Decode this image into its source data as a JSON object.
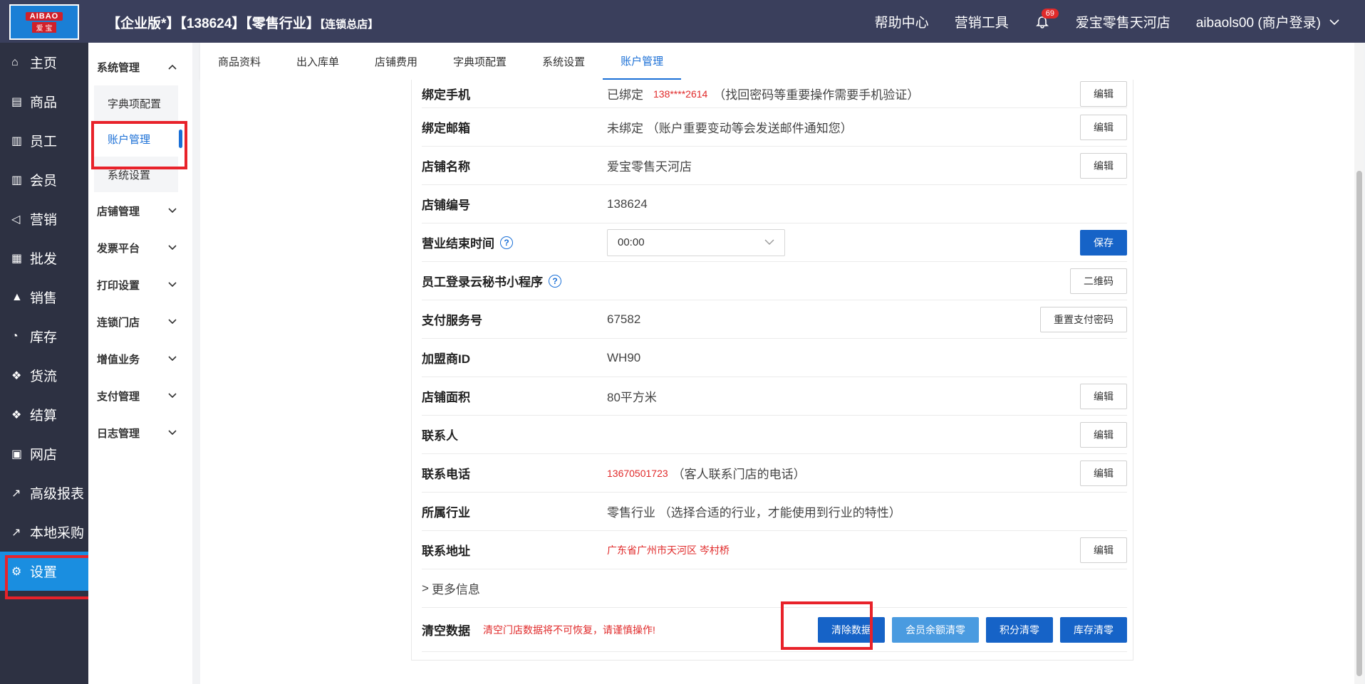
{
  "topbar": {
    "logo_top": "AIBAO",
    "logo_bottom": "爱 宝",
    "version": "【企业版*】【138624】【零售行业】",
    "store_tag": "【连锁总店】",
    "help": "帮助中心",
    "marketing": "营销工具",
    "badge": "69",
    "store": "爱宝零售天河店",
    "user": "aibaols00 (商户登录)"
  },
  "leftnav": [
    {
      "label": "主页",
      "icon": "home-icon"
    },
    {
      "label": "商品",
      "icon": "goods-icon"
    },
    {
      "label": "员工",
      "icon": "staff-icon"
    },
    {
      "label": "会员",
      "icon": "member-icon"
    },
    {
      "label": "营销",
      "icon": "megaphone-icon"
    },
    {
      "label": "批发",
      "icon": "wholesale-icon"
    },
    {
      "label": "销售",
      "icon": "sales-chart-icon"
    },
    {
      "label": "库存",
      "icon": "stock-pie-icon"
    },
    {
      "label": "货流",
      "icon": "flow-icon"
    },
    {
      "label": "结算",
      "icon": "settle-icon"
    },
    {
      "label": "网店",
      "icon": "shop-gift-icon"
    },
    {
      "label": "高级报表",
      "icon": "report-icon"
    },
    {
      "label": "本地采购",
      "icon": "purchase-icon"
    },
    {
      "label": "设置",
      "icon": "gear-icon"
    }
  ],
  "subnav": {
    "system": "系统管理",
    "dict": "字典项配置",
    "account": "账户管理",
    "sysset": "系统设置",
    "groups": [
      "店铺管理",
      "发票平台",
      "打印设置",
      "连锁门店",
      "增值业务",
      "支付管理",
      "日志管理"
    ]
  },
  "tabs": [
    "商品资料",
    "出入库单",
    "店铺费用",
    "字典项配置",
    "系统设置",
    "账户管理"
  ],
  "rows": {
    "phone_label": "绑定手机",
    "phone_status": "已绑定",
    "phone_num": "138****2614",
    "phone_note": "（找回密码等重要操作需要手机验证）",
    "email_label": "绑定邮箱",
    "email_value": "未绑定 （账户重要变动等会发送邮件通知您）",
    "name_label": "店铺名称",
    "name_value": "爱宝零售天河店",
    "code_label": "店铺编号",
    "code_value": "138624",
    "close_label": "营业结束时间",
    "close_value": "00:00",
    "mini_label": "员工登录云秘书小程序",
    "pay_label": "支付服务号",
    "pay_value": "67582",
    "join_label": "加盟商ID",
    "join_value": "WH90",
    "area_label": "店铺面积",
    "area_value": "80平方米",
    "contact_label": "联系人",
    "tel_label": "联系电话",
    "tel_value": "13670501723",
    "tel_note": "（客人联系门店的电话）",
    "ind_label": "所属行业",
    "ind_value": "零售行业 （选择合适的行业，才能使用到行业的特性）",
    "addr_label": "联系地址",
    "addr_value": "广东省广州市天河区 岑村桥",
    "more": "更多信息",
    "clear_label": "清空数据",
    "clear_warn": "清空门店数据将不可恢复，请谨慎操作!"
  },
  "buttons": {
    "edit": "编辑",
    "save": "保存",
    "qr": "二维码",
    "reset_pay": "重置支付密码",
    "clear": "清除数据",
    "member_zero": "会员余额清零",
    "point_zero": "积分清零",
    "stock_zero": "库存清零"
  },
  "colors": {
    "accent": "#1663c7",
    "nav": "#2d3142",
    "topbar": "#3a3f5c",
    "highlight": "#e8222a"
  }
}
